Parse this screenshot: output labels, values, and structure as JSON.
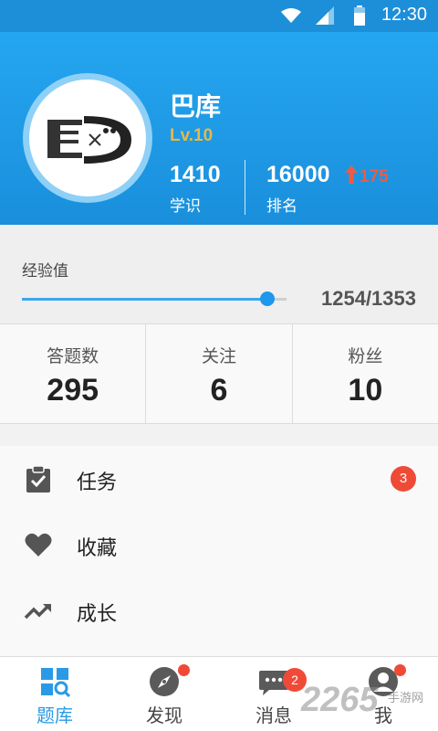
{
  "status_bar": {
    "time": "12:30"
  },
  "profile": {
    "name": "巴库",
    "level": "Lv.10",
    "knowledge_value": "1410",
    "knowledge_label": "学识",
    "rank_value": "16000",
    "rank_change": "175",
    "rank_label": "排名"
  },
  "experience": {
    "label": "经验值",
    "value_text": "1254/1353",
    "progress": 0.927
  },
  "counts": [
    {
      "label": "答题数",
      "value": "295"
    },
    {
      "label": "关注",
      "value": "6"
    },
    {
      "label": "粉丝",
      "value": "10"
    }
  ],
  "menu": {
    "items": [
      {
        "label": "任务",
        "icon": "clipboard-check-icon",
        "badge": "3"
      },
      {
        "label": "收藏",
        "icon": "heart-icon"
      },
      {
        "label": "成长",
        "icon": "trending-up-icon"
      }
    ]
  },
  "tabs": [
    {
      "label": "题库",
      "icon": "grid-search-icon",
      "active": true
    },
    {
      "label": "发现",
      "icon": "compass-icon",
      "dot": true
    },
    {
      "label": "消息",
      "icon": "chat-bubble-icon",
      "badge": "2"
    },
    {
      "label": "我",
      "icon": "user-icon",
      "dot": true
    }
  ],
  "watermark": {
    "text": "2265",
    "subtext": "手游网"
  },
  "colors": {
    "primary": "#1e97ec",
    "badge": "#ef4a38",
    "level": "#e6b84a",
    "rank_up": "#ee5b43"
  }
}
